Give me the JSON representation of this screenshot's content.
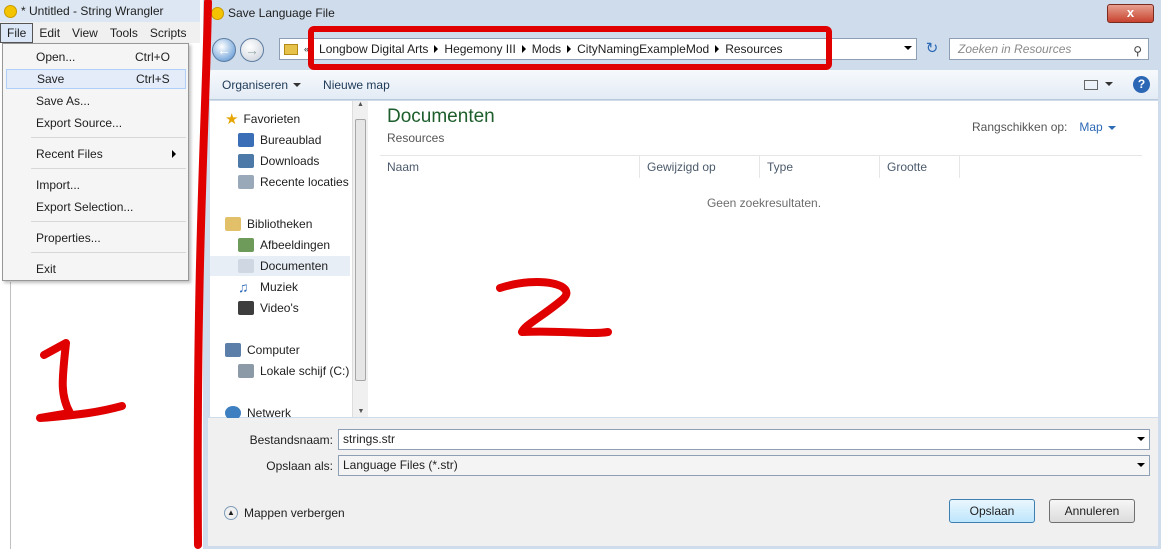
{
  "app": {
    "title": "* Untitled - String Wrangler",
    "menus": [
      "File",
      "Edit",
      "View",
      "Tools",
      "Scripts"
    ],
    "file_menu": [
      {
        "label": "Open...",
        "shortcut": "Ctrl+O"
      },
      {
        "label": "Save",
        "shortcut": "Ctrl+S"
      },
      {
        "label": "Save As...",
        "shortcut": ""
      },
      {
        "label": "Export Source...",
        "shortcut": ""
      },
      {
        "label": "Recent Files",
        "shortcut": ""
      },
      {
        "label": "Import...",
        "shortcut": ""
      },
      {
        "label": "Export Selection...",
        "shortcut": ""
      },
      {
        "label": "Properties...",
        "shortcut": ""
      },
      {
        "label": "Exit",
        "shortcut": ""
      }
    ]
  },
  "dialog": {
    "title": "Save Language File",
    "close": "x",
    "breadcrumbs": [
      "Longbow Digital Arts",
      "Hegemony III",
      "Mods",
      "CityNamingExampleMod",
      "Resources"
    ],
    "search_placeholder": "Zoeken in Resources",
    "toolbar": {
      "organize": "Organiseren",
      "new_folder": "Nieuwe map"
    },
    "nav": {
      "favorites": "Favorieten",
      "fav_items": [
        "Bureaublad",
        "Downloads",
        "Recente locaties"
      ],
      "libraries": "Bibliotheken",
      "lib_items": [
        "Afbeeldingen",
        "Documenten",
        "Muziek",
        "Video's"
      ],
      "computer": "Computer",
      "drive": "Lokale schijf (C:)",
      "network": "Netwerk"
    },
    "content": {
      "title": "Documenten",
      "subtitle": "Resources",
      "arrange_label": "Rangschikken op:",
      "arrange_value": "Map",
      "columns": [
        "Naam",
        "Gewijzigd op",
        "Type",
        "Grootte"
      ],
      "empty": "Geen zoekresultaten."
    },
    "filename_label": "Bestandsnaam:",
    "filename_value": "strings.str",
    "savetype_label": "Opslaan als:",
    "savetype_value": "Language Files (*.str)",
    "hide_folders": "Mappen verbergen",
    "save_button": "Opslaan",
    "cancel_button": "Annuleren"
  },
  "annotations": {
    "one": "1",
    "two": "2",
    "color": "#e00000"
  },
  "colors": {
    "accent": "#2d6ab6",
    "library_title": "#1d5e2c"
  }
}
